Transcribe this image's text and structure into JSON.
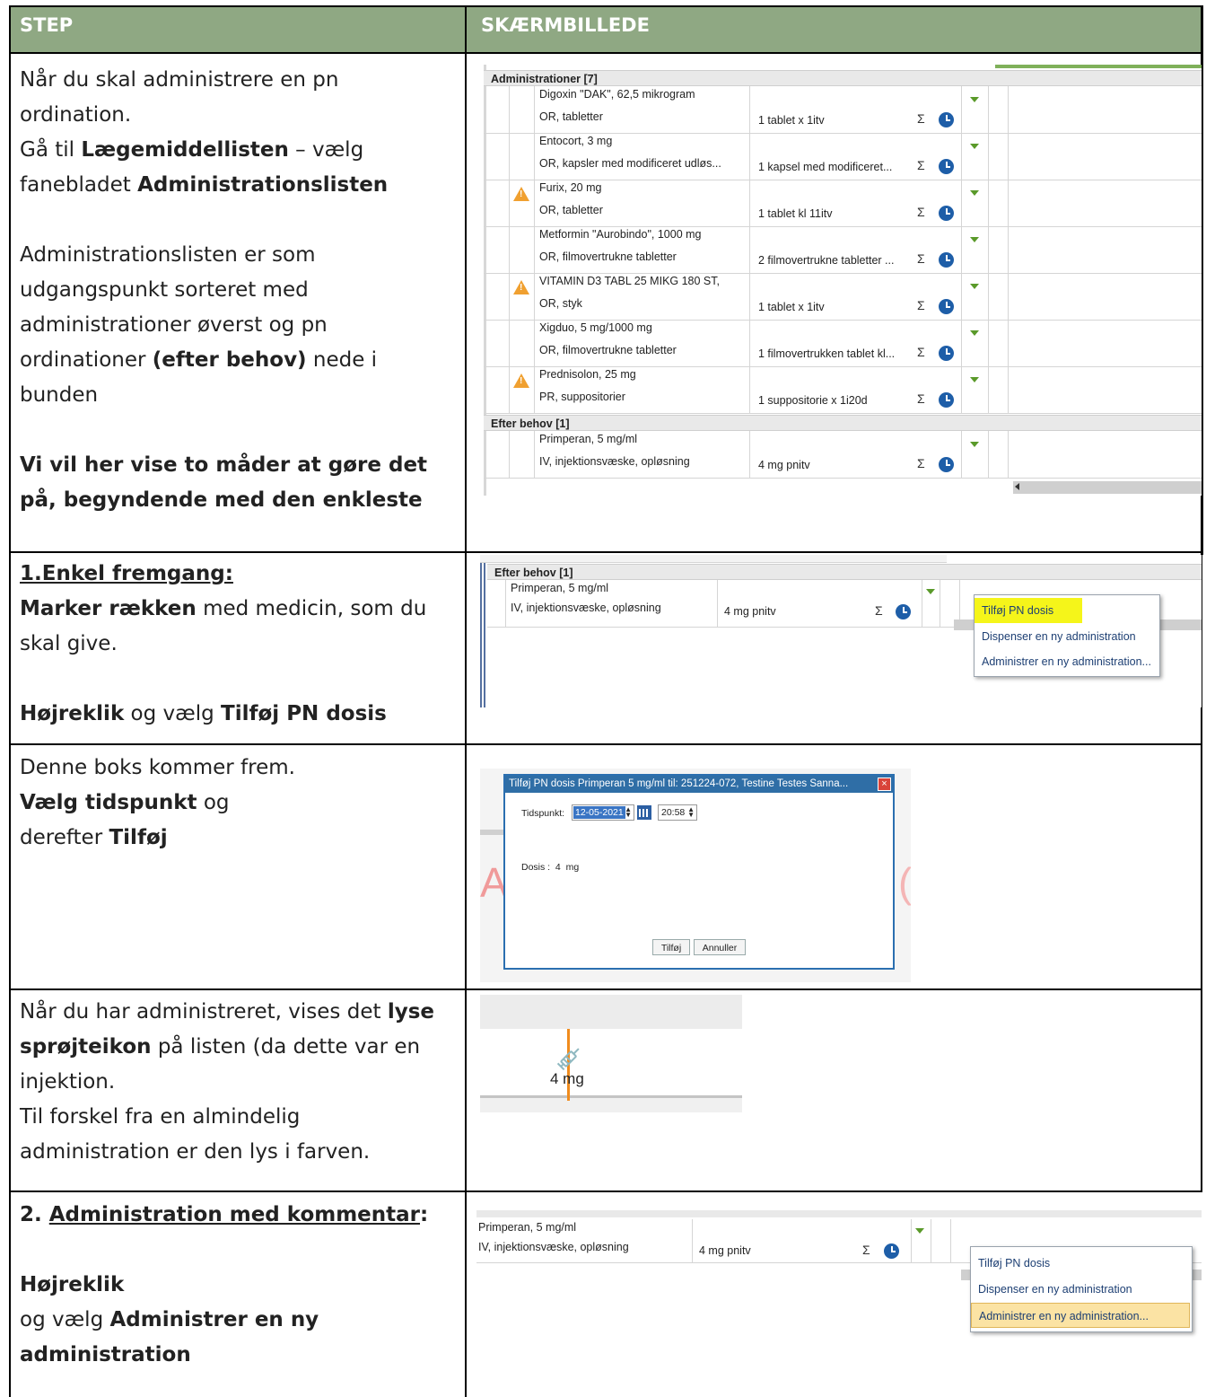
{
  "table": {
    "header": {
      "step": "STEP",
      "screenshot": "SKÆRMBILLEDE"
    }
  },
  "row1": {
    "p1": "Når du skal administrere en pn ordination.",
    "p2a": "Gå til ",
    "p2b": "Lægemiddellisten",
    "p2c": " – vælg fanebladet ",
    "p2d": "Administrationslisten",
    "p3": "Administrationslisten er som udgangspunkt sorteret med administrationer øverst og pn ordinationer ",
    "p3b": "(efter behov)",
    "p3c": " nede i bunden",
    "p4": "Vi vil her vise to måder at gøre det på, begyndende med den enkleste"
  },
  "row2": {
    "title": "1.Enkel fremgang:",
    "p1a": "Marker rækken",
    "p1b": " med medicin, som du skal give.",
    "p2a": "Højreklik",
    "p2b": " og vælg ",
    "p2c": "Tilføj PN dosis"
  },
  "row3": {
    "p1": "Denne boks kommer frem.",
    "p2a": "Vælg tidspunkt",
    "p2b": " og",
    "p3a": "derefter ",
    "p3b": "Tilføj"
  },
  "row4": {
    "p1a": "Når du har administreret, vises det ",
    "p1b": "lyse sprøjteikon",
    "p1c": " på listen (da dette var en injektion.",
    "p2": "Til forskel fra en almindelig administration er den lys i farven."
  },
  "row5": {
    "title_a": "2. ",
    "title_b": "Administration med kommentar",
    "title_c": ":",
    "p1": "Højreklik",
    "p2a": "og vælg ",
    "p2b": "Administrer en ny administration"
  },
  "shot1": {
    "group1": "Administrationer [7]",
    "group2": "Efter behov [1]",
    "meds": [
      {
        "name": "Digoxin \"DAK\", 62,5 mikrogram",
        "form": "OR, tabletter",
        "dose": "1 tablet x 1itv",
        "warn": false
      },
      {
        "name": "Entocort, 3 mg",
        "form": "OR, kapsler med modificeret udløs...",
        "dose": "1 kapsel med modificeret...",
        "warn": false
      },
      {
        "name": "Furix, 20 mg",
        "form": "OR, tabletter",
        "dose": "1 tablet kl 11itv",
        "warn": true
      },
      {
        "name": "Metformin \"Aurobindo\", 1000 mg",
        "form": "OR, filmovertrukne tabletter",
        "dose": "2 filmovertrukne tabletter ...",
        "warn": false
      },
      {
        "name": "VITAMIN D3 TABL 25 MIKG 180 ST,",
        "form": "OR, styk",
        "dose": "1 tablet x 1itv",
        "warn": true
      },
      {
        "name": "Xigduo, 5 mg/1000 mg",
        "form": "OR, filmovertrukne tabletter",
        "dose": "1 filmovertrukken tablet kl...",
        "warn": false
      },
      {
        "name": "Prednisolon, 25 mg",
        "form": "PR, suppositorier",
        "dose": "1 suppositorie x 1i20d",
        "warn": true
      }
    ],
    "pn_med": {
      "name": "Primperan, 5 mg/ml",
      "form": "IV, injektionsvæske, opløsning",
      "dose": "4 mg  pnitv"
    },
    "sigma": "Σ"
  },
  "shot2": {
    "group": "Efter behov [1]",
    "menu": [
      "Tilføj PN dosis",
      "Dispenser en ny administration",
      "Administrer en ny administration..."
    ]
  },
  "shot3": {
    "title": "Tilføj PN dosis Primperan 5 mg/ml til: 251224-072, Testine Testes Sanna...",
    "close": "×",
    "time_label": "Tidspunkt:",
    "date": "12-05-2021",
    "time": "20:58",
    "dose_label": "Dosis :  4  mg",
    "add": "Tilføj",
    "cancel": "Annuller",
    "bg_left": "A",
    "bg_right": "("
  },
  "shot4": {
    "value": "4 mg"
  },
  "shot5": {
    "menu": [
      "Tilføj PN dosis",
      "Dispenser en ny administration",
      "Administrer en ny administration..."
    ]
  },
  "colors": {
    "header": "#8fa883",
    "highlight_yellow": "#f5f51a",
    "highlight_orange": "#fbe3a4",
    "clock_blue": "#1e5ea8",
    "warn_orange": "#f0a030",
    "dialog_blue": "#2f6ea6"
  }
}
